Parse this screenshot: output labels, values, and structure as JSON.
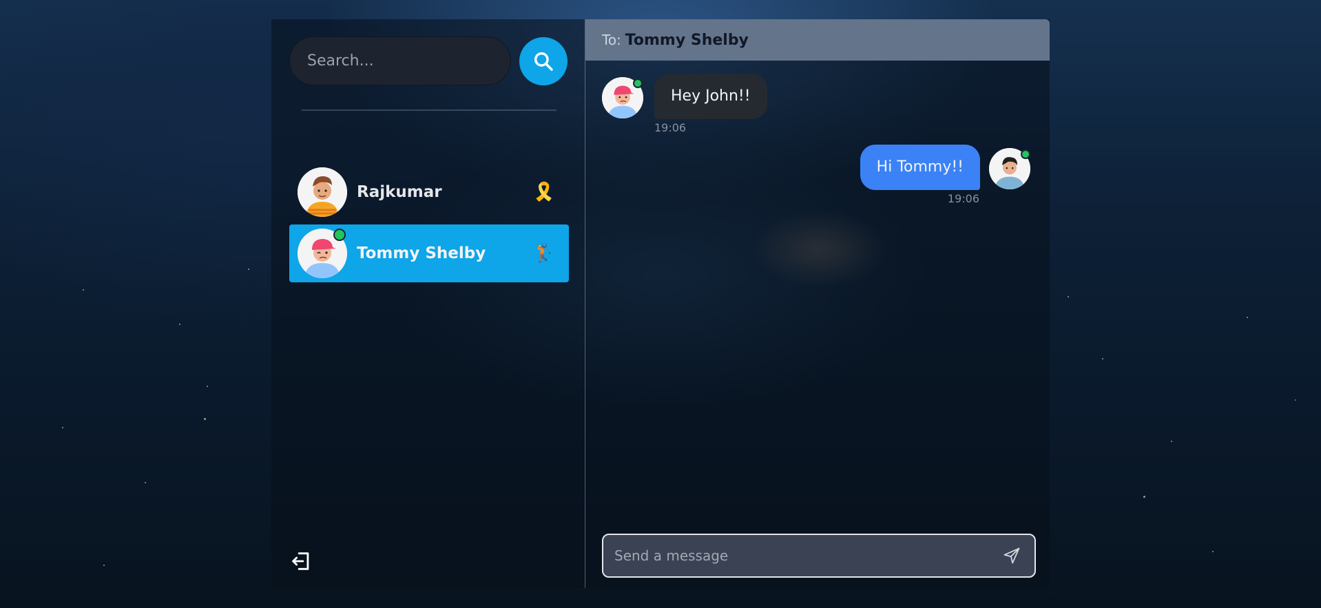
{
  "search": {
    "placeholder": "Search..."
  },
  "contacts": [
    {
      "name": "Rajkumar",
      "emoji": "🎗️",
      "online": false,
      "selected": false
    },
    {
      "name": "Tommy Shelby",
      "emoji": "🏌️",
      "online": true,
      "selected": true
    }
  ],
  "chat": {
    "to_label": "To:",
    "to_name": "Tommy Shelby",
    "messages": [
      {
        "text": "Hey John!!",
        "time": "19:06",
        "direction": "incoming"
      },
      {
        "text": "Hi Tommy!!",
        "time": "19:06",
        "direction": "outgoing"
      }
    ],
    "input_placeholder": "Send a message"
  },
  "colors": {
    "accent": "#0ea5e9",
    "header": "#64748b",
    "outgoing_bubble": "#3b82f6",
    "incoming_bubble": "#252a31",
    "online": "#22c55e"
  },
  "icons": {
    "search": "search-icon",
    "logout": "logout-icon",
    "send": "send-icon"
  }
}
